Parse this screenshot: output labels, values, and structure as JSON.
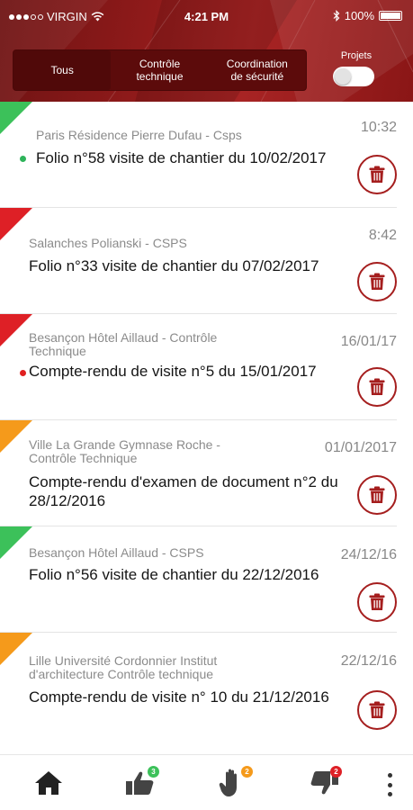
{
  "status_bar": {
    "carrier": "VIRGIN",
    "time": "4:21 PM",
    "battery": "100%"
  },
  "filter": {
    "tabs": [
      {
        "label_line1": "Tous",
        "label_line2": "",
        "active": true
      },
      {
        "label_line1": "Contrôle",
        "label_line2": "technique",
        "active": false
      },
      {
        "label_line1": "Coordination",
        "label_line2": "de sécurité",
        "active": false
      }
    ],
    "projets_label": "Projets",
    "projets_toggle_on": false
  },
  "items": [
    {
      "status_color": "#3cc15a",
      "project": "Paris Résidence Pierre Dufau - Csps",
      "title": "Folio n°58 visite de chantier du 10/02/2017",
      "date": "10:32",
      "unread": true,
      "unread_color": "#2eb35a"
    },
    {
      "status_color": "#de2026",
      "project": "Salanches Polianski - CSPS",
      "title": "Folio n°33 visite de chantier du 07/02/2017",
      "date": "8:42",
      "unread": false
    },
    {
      "status_color": "#de2026",
      "project": "Besançon Hôtel Aillaud - Contrôle Technique",
      "title": "Compte-rendu de visite n°5 du 15/01/2017",
      "date": "16/01/17",
      "unread": true,
      "unread_color": "#e02020"
    },
    {
      "status_color": "#f59a1b",
      "project": "Ville La Grande Gymnase Roche - Contrôle Technique",
      "title": "Compte-rendu d'examen de document n°2 du 28/12/2016",
      "date": "01/01/2017",
      "unread": false
    },
    {
      "status_color": "#3cc15a",
      "project": "Besançon Hôtel Aillaud - CSPS",
      "title": "Folio n°56 visite de chantier du 22/12/2016",
      "date": "24/12/16",
      "unread": false
    },
    {
      "status_color": "#f59a1b",
      "project": "Lille Université Cordonnier Institut d'architecture Contrôle technique",
      "title": "Compte-rendu de visite n° 10 du 21/12/2016",
      "date": "22/12/16",
      "unread": false
    }
  ],
  "bottom_nav": {
    "items": [
      {
        "icon": "home-icon",
        "badge": ""
      },
      {
        "icon": "thumbs-up-icon",
        "badge": "3",
        "badge_color": "#3cc15a"
      },
      {
        "icon": "hand-icon",
        "badge": "2",
        "badge_color": "#f59a1b"
      },
      {
        "icon": "thumbs-down-icon",
        "badge": "2",
        "badge_color": "#de2026"
      }
    ],
    "more_icon": "more-vertical-icon"
  },
  "colors": {
    "header": "#8f1a1a",
    "accent": "#a51e1e"
  }
}
